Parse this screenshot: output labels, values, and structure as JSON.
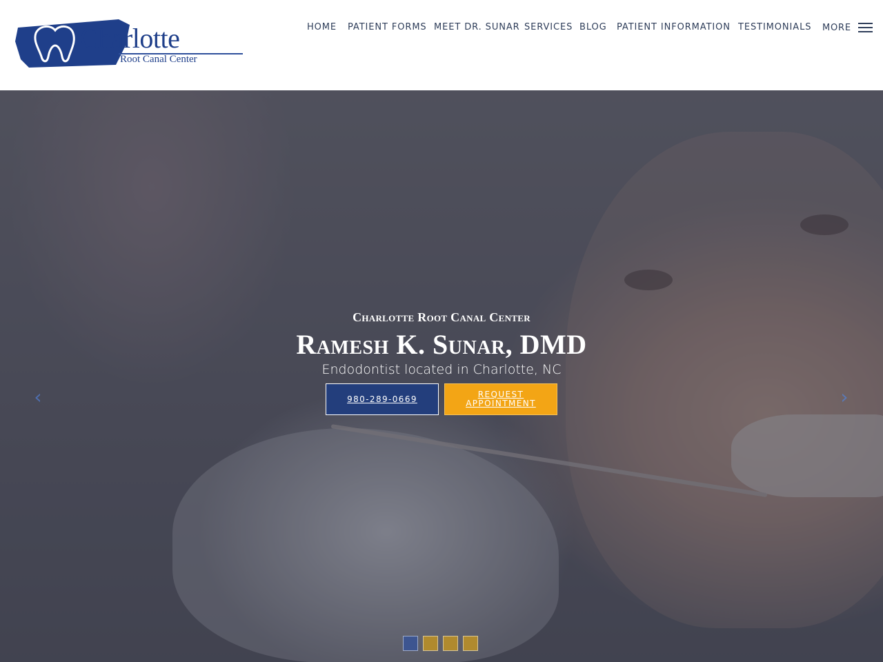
{
  "brand": {
    "name": "Charlotte",
    "subtitle": "Root Canal Center",
    "logo_color": "#1f3f8a"
  },
  "nav": {
    "items": [
      "HOME",
      "PATIENT FORMS",
      "MEET DR. SUNAR",
      "SERVICES",
      "BLOG",
      "PATIENT INFORMATION",
      "TESTIMONIALS"
    ],
    "more_label": "MORE",
    "menu_icon": "hamburger-icon"
  },
  "hero": {
    "kicker": "Charlotte Root Canal Center",
    "doctor": "Ramesh K. Sunar, DMD",
    "tagline": "Endodontist located in Charlotte, NC",
    "phone_button": "980-289-0669",
    "appointment_button": "REQUEST APPOINTMENT",
    "prev_icon": "chevron-left-icon",
    "next_icon": "chevron-right-icon",
    "slides": [
      {
        "active": true,
        "color": "#3d5590"
      },
      {
        "active": false,
        "color": "#b08a2e"
      },
      {
        "active": false,
        "color": "#b08a2e"
      },
      {
        "active": false,
        "color": "#b08a2e"
      }
    ]
  },
  "colors": {
    "primary_blue": "#233e7c",
    "accent_orange": "#f3a515",
    "nav_text": "#2e3d59"
  }
}
